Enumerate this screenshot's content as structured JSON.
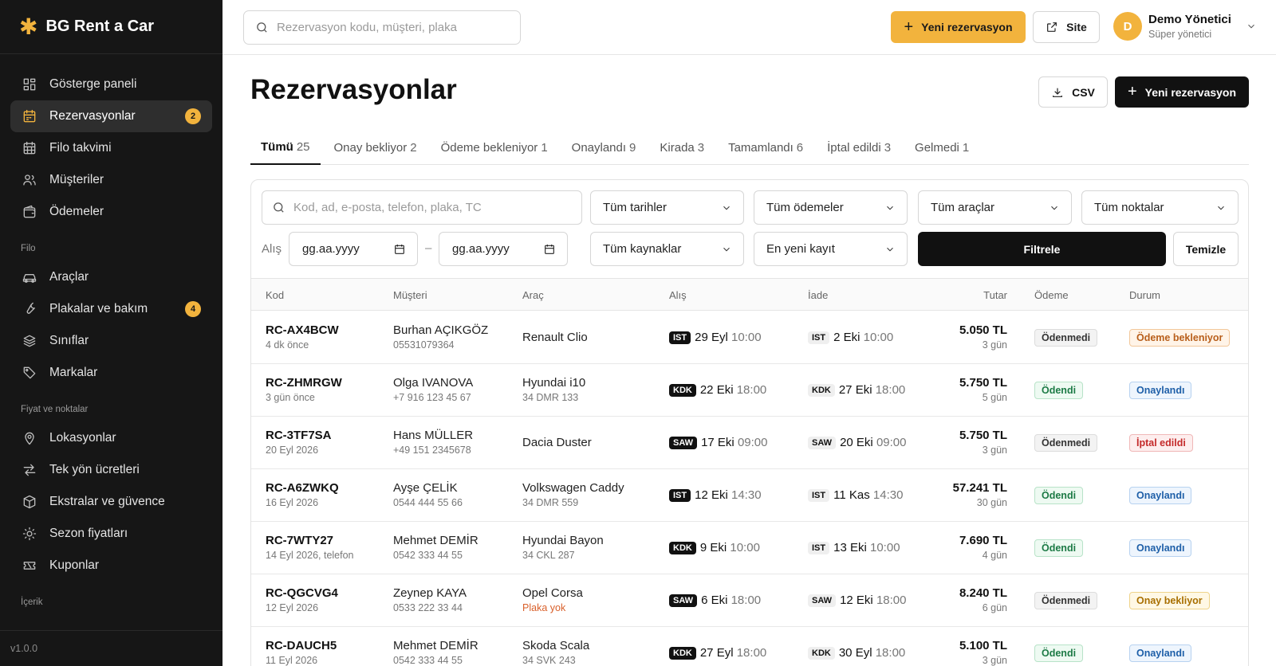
{
  "brand": {
    "name": "BG Rent a Car"
  },
  "sidebar": {
    "main": [
      {
        "label": "Gösterge paneli",
        "icon": "dashboard-icon"
      },
      {
        "label": "Rezervasyonlar",
        "icon": "calendar-icon",
        "badge": "2",
        "active": true
      },
      {
        "label": "Filo takvimi",
        "icon": "calendar-grid-icon"
      },
      {
        "label": "Müşteriler",
        "icon": "users-icon"
      },
      {
        "label": "Ödemeler",
        "icon": "wallet-icon"
      }
    ],
    "section_filo": "Filo",
    "filo": [
      {
        "label": "Araçlar",
        "icon": "car-icon"
      },
      {
        "label": "Plakalar ve bakım",
        "icon": "wrench-icon",
        "badge": "4"
      },
      {
        "label": "Sınıflar",
        "icon": "layers-icon"
      },
      {
        "label": "Markalar",
        "icon": "tag-icon"
      }
    ],
    "section_fiyat": "Fiyat ve noktalar",
    "fiyat": [
      {
        "label": "Lokasyonlar",
        "icon": "map-pin-icon"
      },
      {
        "label": "Tek yön ücretleri",
        "icon": "arrows-icon"
      },
      {
        "label": "Ekstralar ve güvence",
        "icon": "package-icon"
      },
      {
        "label": "Sezon fiyatları",
        "icon": "sun-icon"
      },
      {
        "label": "Kuponlar",
        "icon": "ticket-icon"
      }
    ],
    "section_icerik": "İçerik",
    "version": "v1.0.0"
  },
  "topbar": {
    "search_placeholder": "Rezervasyon kodu, müşteri, plaka",
    "new_btn": "Yeni rezervasyon",
    "site_btn": "Site",
    "user_initial": "D",
    "user_name": "Demo Yönetici",
    "user_role": "Süper yönetici"
  },
  "page": {
    "title": "Rezervasyonlar",
    "csv_btn": "CSV",
    "new_btn": "Yeni rezervasyon"
  },
  "tabs": [
    {
      "label": "Tümü",
      "count": "25",
      "active": true
    },
    {
      "label": "Onay bekliyor",
      "count": "2"
    },
    {
      "label": "Ödeme bekleniyor",
      "count": "1"
    },
    {
      "label": "Onaylandı",
      "count": "9"
    },
    {
      "label": "Kirada",
      "count": "3"
    },
    {
      "label": "Tamamlandı",
      "count": "6"
    },
    {
      "label": "İptal edildi",
      "count": "3"
    },
    {
      "label": "Gelmedi",
      "count": "1"
    }
  ],
  "filters": {
    "search_placeholder": "Kod, ad, e-posta, telefon, plaka, TC",
    "dates": "Tüm tarihler",
    "payments": "Tüm ödemeler",
    "cars": "Tüm araçlar",
    "points": "Tüm noktalar",
    "alis_label": "Alış",
    "date_from": "gg.aa.yyyy",
    "date_dash": "–",
    "date_to": "gg.aa.yyyy",
    "sources": "Tüm kaynaklar",
    "sort": "En yeni kayıt",
    "filter_btn": "Filtrele",
    "clear_btn": "Temizle"
  },
  "table": {
    "headers": {
      "kod": "Kod",
      "musteri": "Müşteri",
      "arac": "Araç",
      "alis": "Alış",
      "iade": "İade",
      "tutar": "Tutar",
      "odeme": "Ödeme",
      "durum": "Durum"
    },
    "rows": [
      {
        "code": "RC-AX4BCW",
        "code_sub": "4 dk önce",
        "customer": "Burhan AÇIKGÖZ",
        "phone": "05531079364",
        "car": "Renault Clio",
        "car_sub": "",
        "pick_loc": "IST",
        "pick_date": "29 Eyl",
        "pick_time": "10:00",
        "ret_loc": "IST",
        "ret_date": "2 Eki",
        "ret_time": "10:00",
        "amount": "5.050 TL",
        "days": "3 gün",
        "payment": "Ödenmedi",
        "pay_class": "p-unpaid",
        "status": "Ödeme bekleniyor",
        "status_class": "s-pending"
      },
      {
        "code": "RC-ZHMRGW",
        "code_sub": "3 gün önce",
        "customer": "Olga IVANOVA",
        "phone": "+7 916 123 45 67",
        "car": "Hyundai i10",
        "car_sub": "34 DMR 133",
        "pick_loc": "KDK",
        "pick_date": "22 Eki",
        "pick_time": "18:00",
        "ret_loc": "KDK",
        "ret_date": "27 Eki",
        "ret_time": "18:00",
        "amount": "5.750 TL",
        "days": "5 gün",
        "payment": "Ödendi",
        "pay_class": "p-paid",
        "status": "Onaylandı",
        "status_class": "s-ok"
      },
      {
        "code": "RC-3TF7SA",
        "code_sub": "20 Eyl 2026",
        "customer": "Hans MÜLLER",
        "phone": "+49 151 2345678",
        "car": "Dacia Duster",
        "car_sub": "",
        "pick_loc": "SAW",
        "pick_date": "17 Eki",
        "pick_time": "09:00",
        "ret_loc": "SAW",
        "ret_date": "20 Eki",
        "ret_time": "09:00",
        "amount": "5.750 TL",
        "days": "3 gün",
        "payment": "Ödenmedi",
        "pay_class": "p-unpaid",
        "status": "İptal edildi",
        "status_class": "s-cancel"
      },
      {
        "code": "RC-A6ZWKQ",
        "code_sub": "16 Eyl 2026",
        "customer": "Ayşe ÇELİK",
        "phone": "0544 444 55 66",
        "car": "Volkswagen Caddy",
        "car_sub": "34 DMR 559",
        "pick_loc": "IST",
        "pick_date": "12 Eki",
        "pick_time": "14:30",
        "ret_loc": "IST",
        "ret_date": "11 Kas",
        "ret_time": "14:30",
        "amount": "57.241 TL",
        "days": "30 gün",
        "payment": "Ödendi",
        "pay_class": "p-paid",
        "status": "Onaylandı",
        "status_class": "s-ok"
      },
      {
        "code": "RC-7WTY27",
        "code_sub": "14 Eyl 2026, telefon",
        "customer": "Mehmet DEMİR",
        "phone": "0542 333 44 55",
        "car": "Hyundai Bayon",
        "car_sub": "34 CKL 287",
        "pick_loc": "KDK",
        "pick_date": "9 Eki",
        "pick_time": "10:00",
        "ret_loc": "IST",
        "ret_date": "13 Eki",
        "ret_time": "10:00",
        "amount": "7.690 TL",
        "days": "4 gün",
        "payment": "Ödendi",
        "pay_class": "p-paid",
        "status": "Onaylandı",
        "status_class": "s-ok"
      },
      {
        "code": "RC-QGCVG4",
        "code_sub": "12 Eyl 2026",
        "customer": "Zeynep KAYA",
        "phone": "0533 222 33 44",
        "car": "Opel Corsa",
        "car_sub": "Plaka yok",
        "car_sub_warn": true,
        "pick_loc": "SAW",
        "pick_date": "6 Eki",
        "pick_time": "18:00",
        "ret_loc": "SAW",
        "ret_date": "12 Eki",
        "ret_time": "18:00",
        "amount": "8.240 TL",
        "days": "6 gün",
        "payment": "Ödenmedi",
        "pay_class": "p-unpaid",
        "status": "Onay bekliyor",
        "status_class": "s-await"
      },
      {
        "code": "RC-DAUCH5",
        "code_sub": "11 Eyl 2026",
        "customer": "Mehmet DEMİR",
        "phone": "0542 333 44 55",
        "car": "Skoda Scala",
        "car_sub": "34 SVK 243",
        "pick_loc": "KDK",
        "pick_date": "27 Eyl",
        "pick_time": "18:00",
        "ret_loc": "KDK",
        "ret_date": "30 Eyl",
        "ret_time": "18:00",
        "amount": "5.100 TL",
        "days": "3 gün",
        "payment": "Ödendi",
        "pay_class": "p-paid",
        "status": "Onaylandı",
        "status_class": "s-ok"
      }
    ]
  }
}
